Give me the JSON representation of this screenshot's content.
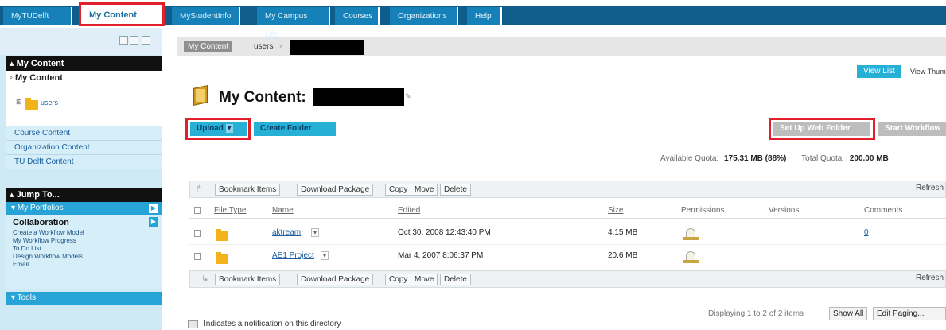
{
  "tabs": [
    {
      "label": "MyTUDelft"
    },
    {
      "label": "My Content"
    },
    {
      "label": "MyStudentInfo"
    },
    {
      "label": "My Campus Life"
    },
    {
      "label": "Courses"
    },
    {
      "label": "Organizations"
    },
    {
      "label": "Help"
    }
  ],
  "left": {
    "my_content_header": "My Content",
    "my_content_link": "My Content",
    "users_folder": "users",
    "nav_links": [
      "Course Content",
      "Organization Content",
      "TU Delft Content"
    ],
    "jump_header": "Jump To...",
    "my_portfolios": "My Portfolios",
    "collaboration_header": "Collaboration",
    "collab_links": [
      "Create a Workflow Model",
      "My Workflow Progress",
      "To Do List",
      "Design Workflow Models",
      "Email"
    ],
    "tools": "Tools"
  },
  "breadcrumb": {
    "root": "My Content",
    "users": "users"
  },
  "view": {
    "list": "View List",
    "thumbnails": "View Thumbnails"
  },
  "page_title": "My Content:",
  "actions": {
    "upload": "Upload",
    "create_folder": "Create Folder",
    "web_folder": "Set Up Web Folder",
    "workflow": "Start Workflow"
  },
  "quota": {
    "available_label": "Available Quota:",
    "available_value": "175.31 MB (88%)",
    "total_label": "Total Quota:",
    "total_value": "200.00 MB"
  },
  "toolbar": {
    "bookmark": "Bookmark Items",
    "download": "Download Package",
    "copy": "Copy",
    "move": "Move",
    "delete": "Delete",
    "refresh": "Refresh"
  },
  "columns": {
    "type": "File Type",
    "name": "Name",
    "edited": "Edited",
    "size": "Size",
    "permissions": "Permissions",
    "versions": "Versions",
    "comments": "Comments"
  },
  "rows": [
    {
      "name": "aktream",
      "edited": "Oct 30, 2008 12:43:40 PM",
      "size": "4.15 MB",
      "comments": "0"
    },
    {
      "name": "AE1 Project",
      "edited": "Mar 4, 2007 8:06:37 PM",
      "size": "20.6 MB",
      "comments": ""
    }
  ],
  "paging": {
    "status": "Displaying 1 to 2 of 2 items",
    "show_all": "Show All",
    "edit": "Edit Paging..."
  },
  "legend": "Indicates a notification on this directory",
  "colors": {
    "tab_bar": "#0e5d8a",
    "tab": "#1581b8",
    "highlight": "#e0202a",
    "button": "#27b0d6"
  }
}
